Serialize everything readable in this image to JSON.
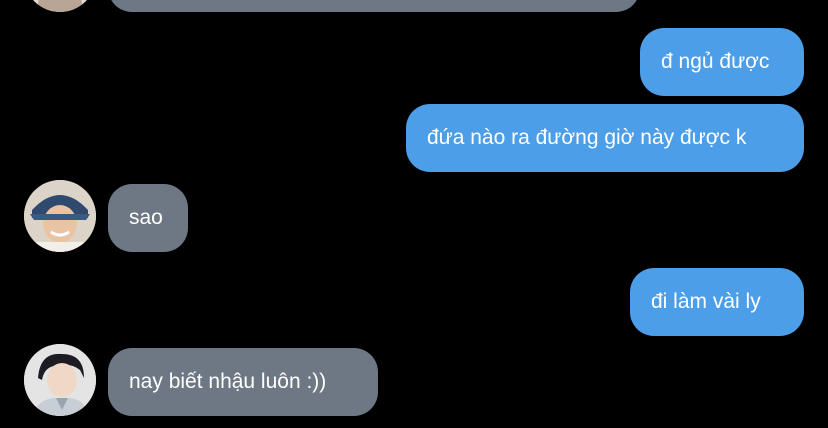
{
  "conversation": {
    "messages": [
      {
        "direction": "received",
        "text": ""
      },
      {
        "direction": "sent",
        "text": "đ ngủ được"
      },
      {
        "direction": "sent",
        "text": "đứa nào ra đường giờ này được k"
      },
      {
        "direction": "received",
        "text": "sao"
      },
      {
        "direction": "sent",
        "text": "đi làm vài ly"
      },
      {
        "direction": "received",
        "text": "nay biết nhậu luôn :))"
      }
    ]
  },
  "colors": {
    "background": "#000000",
    "sent_bubble": "#4c9ee8",
    "received_bubble": "#6e7884",
    "text": "#ffffff"
  },
  "icons": {
    "avatar_1": "user-photo",
    "avatar_2": "user-photo",
    "avatar_3": "user-photo"
  }
}
